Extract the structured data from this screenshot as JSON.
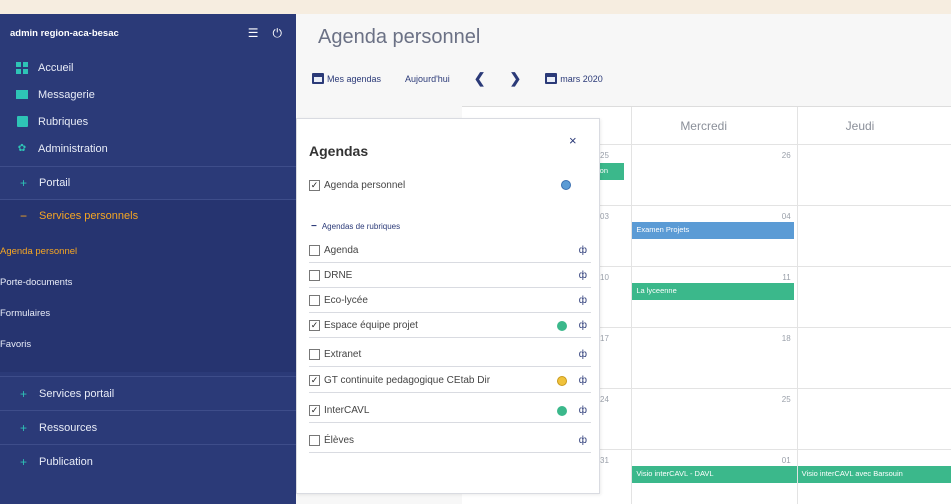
{
  "sidebar": {
    "user": "admin region-aca-besac",
    "top_menu": [
      {
        "label": "Accueil",
        "icon": "home-grid-icon"
      },
      {
        "label": "Messagerie",
        "icon": "envelope-icon"
      },
      {
        "label": "Rubriques",
        "icon": "book-icon"
      },
      {
        "label": "Administration",
        "icon": "gear-icon"
      }
    ],
    "sections": {
      "portail": "Portail",
      "services_personnels": "Services personnels",
      "services_portail": "Services portail",
      "ressources": "Ressources",
      "publication": "Publication"
    },
    "sub_items": [
      "Agenda personnel",
      "Porte-documents",
      "Formulaires",
      "Favoris"
    ]
  },
  "main": {
    "title": "Agenda personnel",
    "toolbar": {
      "my_agendas": "Mes agendas",
      "today": "Aujourd'hui",
      "prev": "❮",
      "next": "❯",
      "month": "mars 2020"
    }
  },
  "calendar": {
    "days": [
      "",
      "Mercredi",
      "Jeudi"
    ],
    "weeks": [
      {
        "c0": "25",
        "c1": "26",
        "c2": "2"
      },
      {
        "c0": "03",
        "c1": "04",
        "c2": "0"
      },
      {
        "c0": "10",
        "c1": "11",
        "c2": "1"
      },
      {
        "c0": "17",
        "c1": "18",
        "c2": "1"
      },
      {
        "c0": "24",
        "c1": "25",
        "c2": "2"
      },
      {
        "c0": "31",
        "c1": "01",
        "c2": "0"
      }
    ],
    "events": {
      "e0": "ion",
      "e1": "Examen Projets",
      "e2": "La lyceenne",
      "e3": "Visio interCAVL - DAVL",
      "e4": "Visio interCAVL avec Barsouin"
    }
  },
  "panel": {
    "title": "Agendas",
    "close": "×",
    "personal": "Agenda personnel",
    "sub_head": "Agendas de rubriques",
    "items": [
      {
        "label": "Agenda",
        "checked": false
      },
      {
        "label": "DRNE",
        "checked": false
      },
      {
        "label": "Eco-lycée",
        "checked": false
      },
      {
        "label": "Espace équipe projet",
        "checked": true
      },
      {
        "label": "Extranet",
        "checked": false
      },
      {
        "label": "GT continuite pedagogique CEtab Dir",
        "checked": true
      },
      {
        "label": "InterCAVL",
        "checked": true
      },
      {
        "label": "Élèves",
        "checked": false
      }
    ],
    "check_mark": "✓",
    "share_glyph": "ф",
    "colors": {
      "personal": "#5b9bd5",
      "espace": "#3bb88b",
      "gt": "#f0c23b",
      "intercavl": "#3bb88b"
    }
  }
}
